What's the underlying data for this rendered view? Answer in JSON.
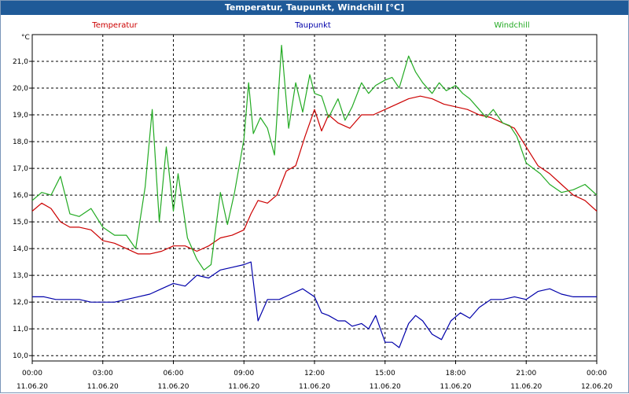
{
  "title": "Temperatur, Taupunkt, Windchill [°C]",
  "chart_data": {
    "type": "line",
    "title": "Temperatur, Taupunkt, Windchill [°C]",
    "ylabel": "°C",
    "ylim": [
      9.8,
      22.0
    ],
    "yticks": [
      "10,0",
      "11,0",
      "12,0",
      "13,0",
      "14,0",
      "15,0",
      "16,0",
      "17,0",
      "18,0",
      "19,0",
      "20,0",
      "21,0"
    ],
    "xlim_hours": [
      0,
      24
    ],
    "xticks": [
      {
        "time": "00:00",
        "date": "11.06.20"
      },
      {
        "time": "03:00",
        "date": "11.06.20"
      },
      {
        "time": "06:00",
        "date": "11.06.20"
      },
      {
        "time": "09:00",
        "date": "11.06.20"
      },
      {
        "time": "12:00",
        "date": "11.06.20"
      },
      {
        "time": "15:00",
        "date": "11.06.20"
      },
      {
        "time": "18:00",
        "date": "11.06.20"
      },
      {
        "time": "21:00",
        "date": "11.06.20"
      },
      {
        "time": "00:00",
        "date": "12.06.20"
      }
    ],
    "grid": true,
    "legend_placement": "top",
    "series": [
      {
        "name": "Temperatur",
        "color": "#cc0000",
        "hours": [
          0,
          0.4,
          0.8,
          1.2,
          1.6,
          2.0,
          2.5,
          3.0,
          3.5,
          4.0,
          4.5,
          5.0,
          5.5,
          6.0,
          6.5,
          7.0,
          7.5,
          8.0,
          8.5,
          9.0,
          9.3,
          9.6,
          10.0,
          10.4,
          10.8,
          11.2,
          11.6,
          12.0,
          12.3,
          12.6,
          13.0,
          13.5,
          14.0,
          14.5,
          15.0,
          15.5,
          16.0,
          16.5,
          17.0,
          17.5,
          18.0,
          18.5,
          19.0,
          19.5,
          20.0,
          20.5,
          21.0,
          21.5,
          22.0,
          22.5,
          23.0,
          23.5,
          24.0
        ],
        "values": [
          15.4,
          15.7,
          15.5,
          15.0,
          14.8,
          14.8,
          14.7,
          14.3,
          14.2,
          14.0,
          13.8,
          13.8,
          13.9,
          14.1,
          14.1,
          13.9,
          14.1,
          14.4,
          14.5,
          14.7,
          15.3,
          15.8,
          15.7,
          16.0,
          16.9,
          17.1,
          18.2,
          19.2,
          18.4,
          19.0,
          18.7,
          18.5,
          19.0,
          19.0,
          19.2,
          19.4,
          19.6,
          19.7,
          19.6,
          19.4,
          19.3,
          19.2,
          19.0,
          18.9,
          18.7,
          18.5,
          17.8,
          17.1,
          16.8,
          16.4,
          16.0,
          15.8,
          15.4
        ]
      },
      {
        "name": "Taupunkt",
        "color": "#0000aa",
        "hours": [
          0,
          0.5,
          1.0,
          1.5,
          2.0,
          2.5,
          3.0,
          3.5,
          4.0,
          4.5,
          5.0,
          5.5,
          6.0,
          6.5,
          7.0,
          7.5,
          8.0,
          8.5,
          9.0,
          9.3,
          9.6,
          10.0,
          10.5,
          11.0,
          11.5,
          12.0,
          12.3,
          12.6,
          13.0,
          13.3,
          13.6,
          14.0,
          14.3,
          14.6,
          15.0,
          15.3,
          15.6,
          16.0,
          16.3,
          16.6,
          17.0,
          17.4,
          17.8,
          18.2,
          18.6,
          19.0,
          19.5,
          20.0,
          20.5,
          21.0,
          21.5,
          22.0,
          22.5,
          23.0,
          23.5,
          24.0
        ],
        "values": [
          12.2,
          12.2,
          12.1,
          12.1,
          12.1,
          12.0,
          12.0,
          12.0,
          12.1,
          12.2,
          12.3,
          12.5,
          12.7,
          12.6,
          13.0,
          12.9,
          13.2,
          13.3,
          13.4,
          13.5,
          11.3,
          12.1,
          12.1,
          12.3,
          12.5,
          12.2,
          11.6,
          11.5,
          11.3,
          11.3,
          11.1,
          11.2,
          11.0,
          11.5,
          10.5,
          10.5,
          10.3,
          11.2,
          11.5,
          11.3,
          10.8,
          10.6,
          11.3,
          11.6,
          11.4,
          11.8,
          12.1,
          12.1,
          12.2,
          12.1,
          12.4,
          12.5,
          12.3,
          12.2,
          12.2,
          12.2
        ]
      },
      {
        "name": "Windchill",
        "color": "#22aa22",
        "hours": [
          0,
          0.4,
          0.8,
          1.2,
          1.6,
          2.0,
          2.5,
          3.0,
          3.5,
          4.0,
          4.4,
          4.8,
          5.1,
          5.4,
          5.7,
          6.0,
          6.2,
          6.6,
          7.0,
          7.3,
          7.6,
          8.0,
          8.3,
          8.6,
          9.0,
          9.2,
          9.4,
          9.7,
          10.0,
          10.3,
          10.6,
          10.9,
          11.2,
          11.5,
          11.8,
          12.0,
          12.3,
          12.6,
          13.0,
          13.3,
          13.6,
          14.0,
          14.3,
          14.6,
          15.0,
          15.3,
          15.6,
          16.0,
          16.3,
          16.6,
          17.0,
          17.3,
          17.6,
          18.0,
          18.3,
          18.6,
          19.0,
          19.3,
          19.6,
          20.0,
          20.3,
          20.6,
          21.0,
          21.3,
          21.6,
          22.0,
          22.5,
          23.0,
          23.5,
          24.0
        ],
        "values": [
          15.8,
          16.1,
          16.0,
          16.7,
          15.3,
          15.2,
          15.5,
          14.8,
          14.5,
          14.5,
          14.0,
          16.3,
          19.2,
          15.0,
          17.8,
          15.4,
          16.8,
          14.4,
          13.6,
          13.2,
          13.4,
          16.1,
          14.9,
          16.1,
          18.1,
          20.2,
          18.3,
          18.9,
          18.5,
          17.5,
          21.6,
          18.5,
          20.2,
          19.1,
          20.5,
          19.8,
          19.7,
          18.9,
          19.6,
          18.8,
          19.3,
          20.2,
          19.8,
          20.1,
          20.3,
          20.4,
          20.0,
          21.2,
          20.6,
          20.2,
          19.8,
          20.2,
          19.9,
          20.1,
          19.8,
          19.6,
          19.2,
          18.9,
          19.2,
          18.7,
          18.6,
          18.2,
          17.2,
          17.0,
          16.8,
          16.4,
          16.1,
          16.2,
          16.4,
          16.0
        ]
      }
    ]
  }
}
